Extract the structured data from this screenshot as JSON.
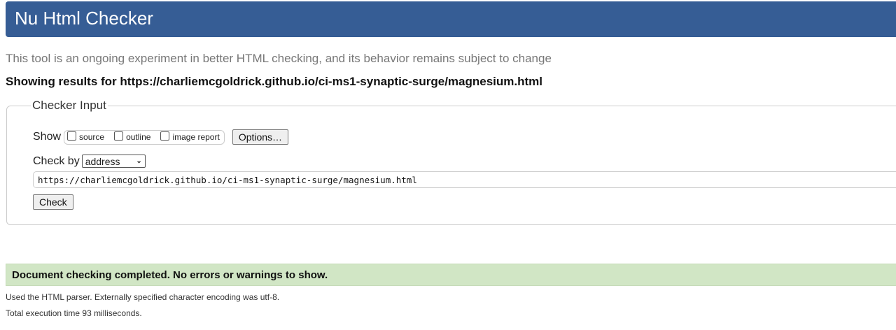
{
  "header": {
    "title": "Nu Html Checker"
  },
  "intro": "This tool is an ongoing experiment in better HTML checking, and its behavior remains subject to change",
  "showing_results": "Showing results for https://charliemcgoldrick.github.io/ci-ms1-synaptic-surge/magnesium.html",
  "checker_input": {
    "legend": "Checker Input",
    "show_label": "Show",
    "show_options": [
      {
        "label": "source",
        "checked": false
      },
      {
        "label": "outline",
        "checked": false
      },
      {
        "label": "image report",
        "checked": false
      }
    ],
    "options_button": "Options…",
    "check_by_label": "Check by",
    "check_by_value": "address",
    "url_value": "https://charliemcgoldrick.github.io/ci-ms1-synaptic-surge/magnesium.html",
    "check_button": "Check"
  },
  "result": {
    "message": "Document checking completed. No errors or warnings to show.",
    "color": "#d1e6c5"
  },
  "details": [
    "Used the HTML parser. Externally specified character encoding was utf-8.",
    "Total execution time 93 milliseconds."
  ],
  "colors": {
    "header": "#365d95"
  }
}
